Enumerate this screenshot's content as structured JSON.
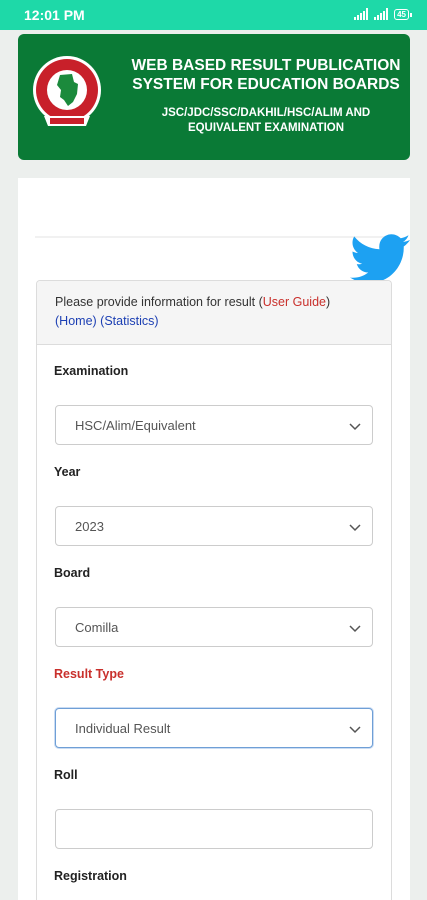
{
  "status_bar": {
    "time": "12:01 PM",
    "battery": "45"
  },
  "header": {
    "title": "WEB BASED RESULT PUBLICATION SYSTEM FOR EDUCATION BOARDS",
    "subtitle": "JSC/JDC/SSC/DAKHIL/HSC/ALIM AND EQUIVALENT EXAMINATION",
    "brand_color": "#0a7a36"
  },
  "form": {
    "intro": "Please provide information for result",
    "links": {
      "user_guide": "User Guide",
      "home": "Home",
      "statistics": "Statistics"
    },
    "fields": {
      "examination": {
        "label": "Examination",
        "value": "HSC/Alim/Equivalent"
      },
      "year": {
        "label": "Year",
        "value": "2023"
      },
      "board": {
        "label": "Board",
        "value": "Comilla"
      },
      "result_type": {
        "label": "Result Type",
        "value": "Individual Result"
      },
      "roll": {
        "label": "Roll",
        "value": ""
      },
      "registration": {
        "label": "Registration"
      }
    }
  },
  "colors": {
    "status_bar": "#1ed9a8",
    "link_red": "#c9302c",
    "link_blue": "#1c3fb3",
    "twitter": "#1da1f2"
  }
}
